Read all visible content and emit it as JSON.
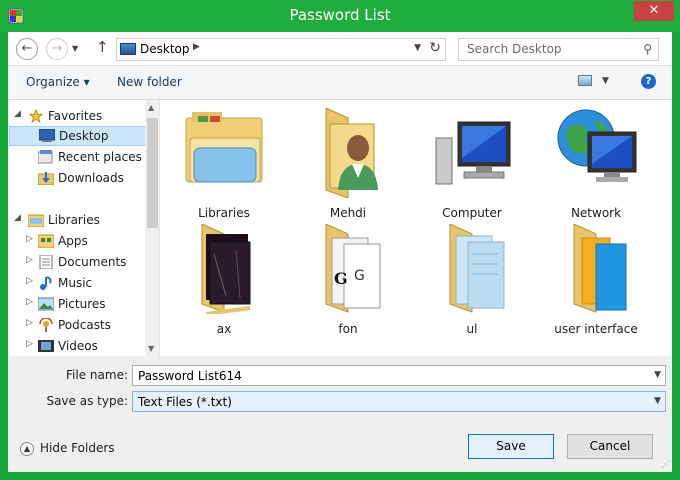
{
  "window": {
    "title": "Password List"
  },
  "nav": {
    "address": "Desktop",
    "search_placeholder": "Search Desktop"
  },
  "toolbar": {
    "organize": "Organize ▾",
    "new_folder": "New folder"
  },
  "sidebar": {
    "items": [
      {
        "label": "Favorites",
        "level": 0,
        "icon": "star-icon"
      },
      {
        "label": "Desktop",
        "level": 1,
        "icon": "desktop-icon",
        "selected": true
      },
      {
        "label": "Recent places",
        "level": 1,
        "icon": "recent-places-icon"
      },
      {
        "label": "Downloads",
        "level": 1,
        "icon": "downloads-icon"
      },
      {
        "label": "Libraries",
        "level": 0,
        "icon": "libraries-icon"
      },
      {
        "label": "Apps",
        "level": 1,
        "icon": "apps-icon"
      },
      {
        "label": "Documents",
        "level": 1,
        "icon": "documents-icon"
      },
      {
        "label": "Music",
        "level": 1,
        "icon": "music-icon"
      },
      {
        "label": "Pictures",
        "level": 1,
        "icon": "pictures-icon"
      },
      {
        "label": "Podcasts",
        "level": 1,
        "icon": "podcasts-icon"
      },
      {
        "label": "Videos",
        "level": 1,
        "icon": "videos-icon"
      }
    ]
  },
  "content": {
    "items": [
      {
        "label": "Libraries",
        "icon": "libraries-folder-icon"
      },
      {
        "label": "Mehdi",
        "icon": "user-folder-icon"
      },
      {
        "label": "Computer",
        "icon": "computer-icon"
      },
      {
        "label": "Network",
        "icon": "network-icon"
      },
      {
        "label": "ax",
        "icon": "folder-icon"
      },
      {
        "label": "fon",
        "icon": "folder-icon"
      },
      {
        "label": "ul",
        "icon": "folder-icon"
      },
      {
        "label": "user interface",
        "icon": "folder-icon"
      }
    ]
  },
  "fields": {
    "file_name_label": "File name:",
    "file_name_value": "Password List614",
    "save_type_label": "Save as type:",
    "save_type_value": "Text Files (*.txt)"
  },
  "footer": {
    "hide_folders": "Hide Folders",
    "save": "Save",
    "cancel": "Cancel"
  }
}
